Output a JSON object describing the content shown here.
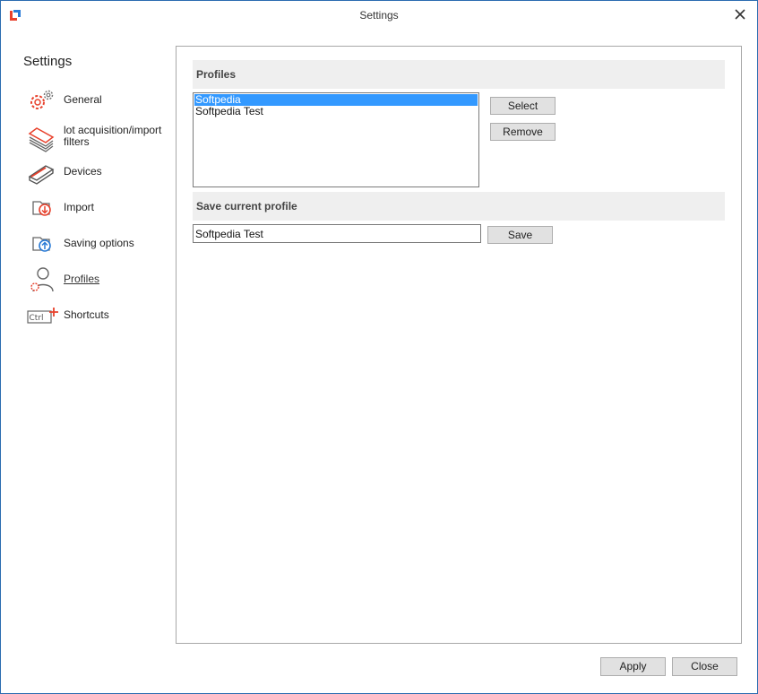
{
  "window": {
    "title": "Settings"
  },
  "sidebar": {
    "heading": "Settings",
    "items": [
      {
        "label": "General",
        "icon": "gears-icon",
        "active": false
      },
      {
        "label": "lot acquisition/import filters",
        "icon": "stacked-sheets-icon",
        "active": false
      },
      {
        "label": "Devices",
        "icon": "scanner-icon",
        "active": false
      },
      {
        "label": "Import",
        "icon": "import-down-arrow-icon",
        "active": false
      },
      {
        "label": "Saving options",
        "icon": "saving-up-arrow-icon",
        "active": false
      },
      {
        "label": "Profiles",
        "icon": "user-profile-icon",
        "active": true
      },
      {
        "label": "Shortcuts",
        "icon": "ctrl-plus-icon",
        "active": false
      }
    ]
  },
  "profiles": {
    "header": "Profiles",
    "list": [
      {
        "label": "Softpedia",
        "selected": true
      },
      {
        "label": "Softpedia Test",
        "selected": false
      }
    ],
    "select_label": "Select",
    "remove_label": "Remove"
  },
  "save_profile": {
    "header": "Save current profile",
    "value": "Softpedia Test",
    "save_label": "Save"
  },
  "footer": {
    "apply_label": "Apply",
    "close_label": "Close"
  },
  "colors": {
    "accent": "#e8412c",
    "selection": "#3399ff",
    "section_bg": "#efefef"
  }
}
